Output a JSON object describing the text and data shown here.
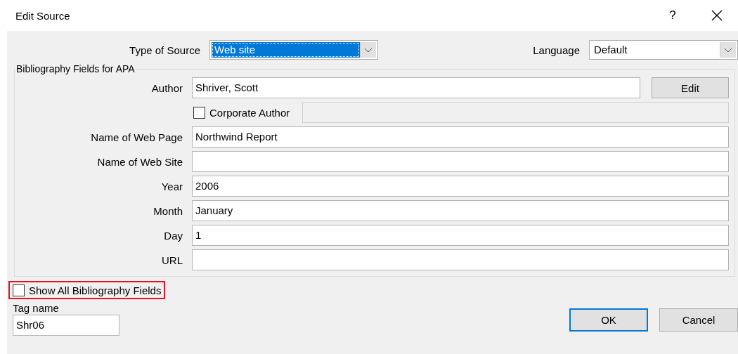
{
  "window": {
    "title": "Edit Source",
    "help": "?"
  },
  "source_type": {
    "label": "Type of Source",
    "value": "Web site",
    "highlighted": true
  },
  "language": {
    "label": "Language",
    "value": "Default"
  },
  "group": {
    "title": "Bibliography Fields for APA",
    "rows": [
      {
        "kind": "text",
        "label": "Author",
        "value": "Shriver, Scott",
        "button": "Edit"
      },
      {
        "kind": "checkbox",
        "label": "Corporate Author",
        "checked": false,
        "field_disabled": true
      },
      {
        "kind": "text",
        "label": "Name of Web Page",
        "value": "Northwind Report"
      },
      {
        "kind": "text",
        "label": "Name of Web Site"
      },
      {
        "kind": "text",
        "label": "Year",
        "value": "2006"
      },
      {
        "kind": "text",
        "label": "Month",
        "value": "January"
      },
      {
        "kind": "text",
        "label": "Day",
        "value": "1"
      },
      {
        "kind": "text",
        "label": "URL"
      }
    ]
  },
  "show_all": {
    "label": "Show All Bibliography Fields",
    "checked": false,
    "highlighted": true
  },
  "tag": {
    "label": "Tag name",
    "value": "Shr06"
  },
  "buttons": [
    {
      "label": "OK",
      "default": true
    },
    {
      "label": "Cancel",
      "default": false
    }
  ]
}
